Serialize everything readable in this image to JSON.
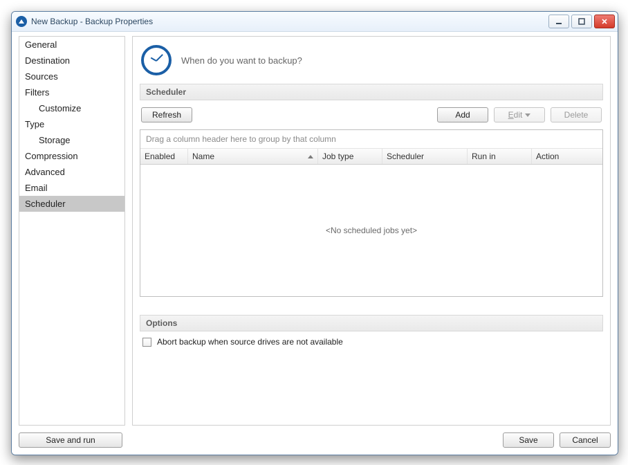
{
  "window": {
    "title": "New Backup - Backup Properties"
  },
  "sidebar": [
    {
      "label": "General",
      "child": false,
      "selected": false
    },
    {
      "label": "Destination",
      "child": false,
      "selected": false
    },
    {
      "label": "Sources",
      "child": false,
      "selected": false
    },
    {
      "label": "Filters",
      "child": false,
      "selected": false
    },
    {
      "label": "Customize",
      "child": true,
      "selected": false
    },
    {
      "label": "Type",
      "child": false,
      "selected": false
    },
    {
      "label": "Storage",
      "child": true,
      "selected": false
    },
    {
      "label": "Compression",
      "child": false,
      "selected": false
    },
    {
      "label": "Advanced",
      "child": false,
      "selected": false
    },
    {
      "label": "Email",
      "child": false,
      "selected": false
    },
    {
      "label": "Scheduler",
      "child": false,
      "selected": true
    }
  ],
  "main": {
    "header_text": "When do you want to backup?",
    "scheduler_section": "Scheduler",
    "buttons": {
      "refresh": "Refresh",
      "add": "Add",
      "edit": "Edit",
      "delete": "Delete"
    },
    "grid": {
      "group_hint": "Drag a column header here to group by that column",
      "columns": [
        "Enabled",
        "Name",
        "Job type",
        "Scheduler",
        "Run in",
        "Action"
      ],
      "sorted_column_index": 1,
      "sort_direction": "asc",
      "rows": [],
      "empty_text": "<No scheduled jobs yet>"
    },
    "options_section": "Options",
    "options": {
      "abort_label": "Abort backup when source drives are not available",
      "abort_checked": false
    }
  },
  "footer": {
    "save_and_run": "Save and run",
    "save": "Save",
    "cancel": "Cancel"
  }
}
